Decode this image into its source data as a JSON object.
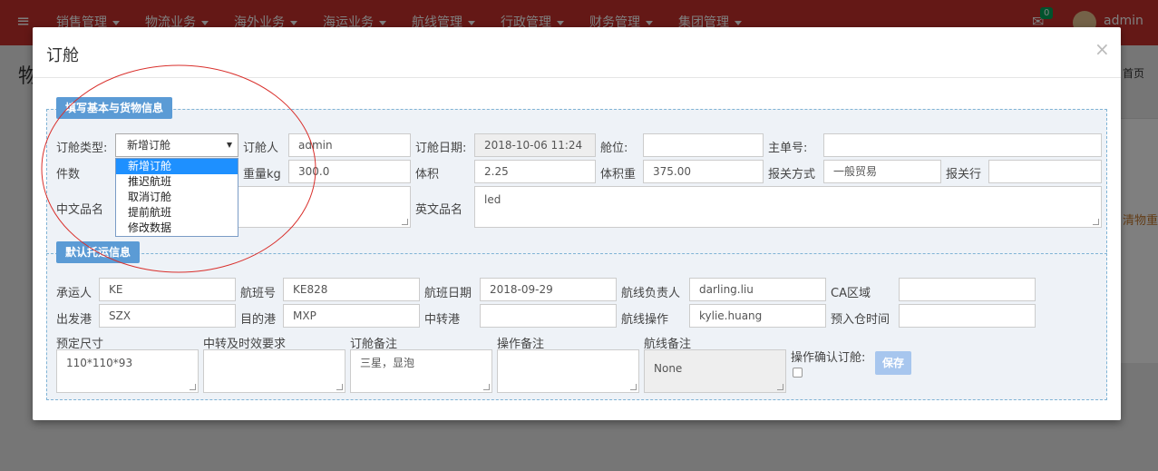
{
  "navbar": {
    "toggle_icon": "≡",
    "menu": [
      "销售管理",
      "物流业务",
      "海外业务",
      "海运业务",
      "航线管理",
      "行政管理",
      "财务管理",
      "集团管理"
    ],
    "mail_icon": "✉",
    "mail_badge": "0",
    "username": "admin"
  },
  "page": {
    "title": "物",
    "crumb": "首页",
    "side_link": "清物重"
  },
  "modal": {
    "title": "订舱",
    "close": "×",
    "section1": {
      "title": "填写基本与货物信息",
      "booking_type_label": "订舱类型:",
      "booking_type_value": "新增订舱",
      "booking_type_options": [
        "新增订舱",
        "推迟航班",
        "取消订舱",
        "提前航班",
        "修改数据"
      ],
      "booker_label": "订舱人",
      "booker_value": "admin",
      "booking_date_label": "订舱日期:",
      "booking_date_value": "2018-10-06 11:24",
      "space_label": "舱位:",
      "space_value": "",
      "master_no_label": "主单号:",
      "master_no_value": "",
      "pieces_label": "件数",
      "pieces_value": "",
      "weight_label": "重量kg",
      "weight_value": "300.0",
      "volume_label": "体积",
      "volume_value": "2.25",
      "vol_weight_label": "体积重",
      "vol_weight_value": "375.00",
      "customs_mode_label": "报关方式",
      "customs_mode_value": "一般贸易",
      "customs_broker_label": "报关行",
      "customs_broker_value": "",
      "cn_name_label": "中文品名",
      "cn_name_value": "",
      "en_name_label": "英文品名",
      "en_name_value": "led"
    },
    "section2": {
      "title": "默认托运信息",
      "carrier_label": "承运人",
      "carrier_value": "KE",
      "flight_no_label": "航班号",
      "flight_no_value": "KE828",
      "flight_date_label": "航班日期",
      "flight_date_value": "2018-09-29",
      "route_owner_label": "航线负责人",
      "route_owner_value": "darling.liu",
      "ca_area_label": "CA区域",
      "ca_area_value": "",
      "origin_label": "出发港",
      "origin_value": "SZX",
      "dest_label": "目的港",
      "dest_value": "MXP",
      "transit_label": "中转港",
      "transit_value": "",
      "route_op_label": "航线操作",
      "route_op_value": "kylie.huang",
      "warehouse_time_label": "预入仓时间",
      "warehouse_time_value": "",
      "size_label": "预定尺寸",
      "size_value": "110*110*93",
      "transit_req_label": "中转及时效要求",
      "transit_req_value": "",
      "booking_note_label": "订舱备注",
      "booking_note_value": "三星，显泡",
      "op_note_label": "操作备注",
      "op_note_value": "",
      "route_note_label": "航线备注",
      "route_note_value": "None",
      "confirm_label": "操作确认订舱:",
      "save_label": "保存"
    }
  },
  "colors": {
    "navbar": "#c9302c",
    "section_title": "#5b9bd5",
    "annotation": "#d9302c",
    "dropdown_selected": "#1e90ff"
  }
}
